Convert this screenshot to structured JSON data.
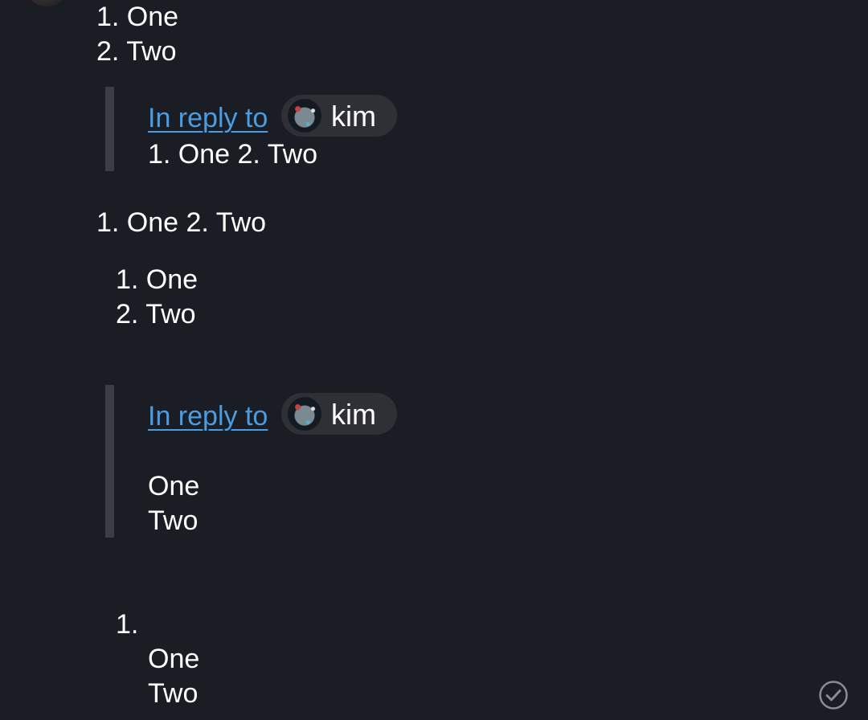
{
  "block1": {
    "items": [
      "1. One",
      "2. Two"
    ]
  },
  "reply1": {
    "link_text": "In reply to",
    "user_name": "kim",
    "user_avatar_icon": "avatar-kim-icon",
    "quote_text": "1. One 2. Two"
  },
  "block2": {
    "text": "1. One 2. Two"
  },
  "block3": {
    "items": [
      "1. One",
      "2. Two"
    ]
  },
  "reply2": {
    "link_text": "In reply to",
    "user_name": "kim",
    "user_avatar_icon": "avatar-kim-icon",
    "lines": [
      "One",
      "Two"
    ]
  },
  "block4": {
    "marker": "1.",
    "lines": [
      "One",
      "Two"
    ]
  },
  "status": {
    "icon": "check-circle-icon"
  },
  "colors": {
    "background": "#1a1d24",
    "link": "#4a9de3",
    "text": "#ffffff",
    "pill": "#2e3035",
    "quote_bar": "#3b3e44"
  }
}
